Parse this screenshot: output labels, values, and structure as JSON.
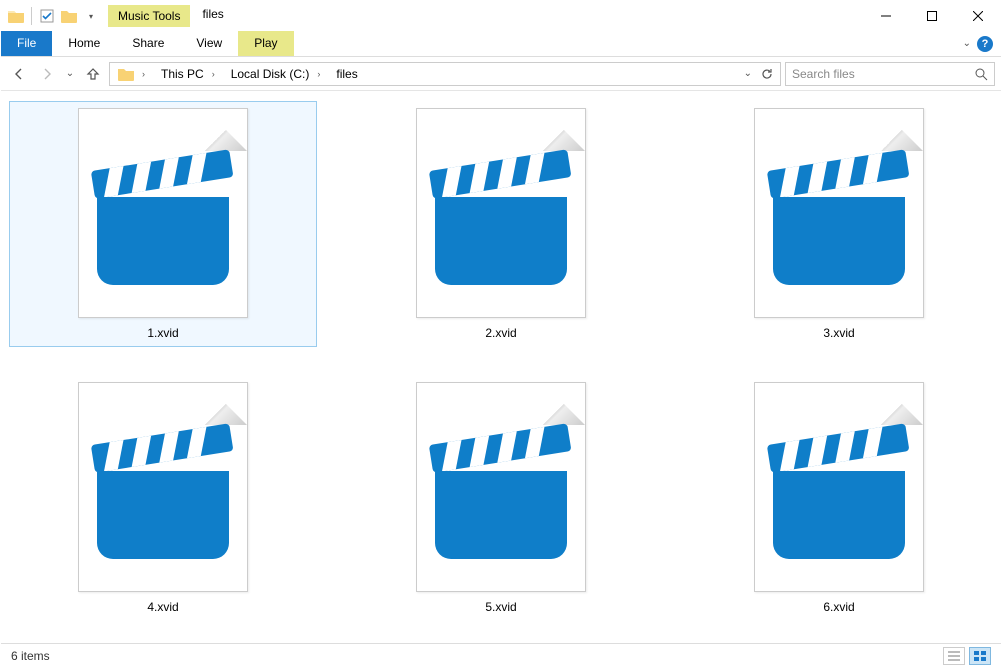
{
  "window": {
    "title": "files",
    "context_tab": "Music Tools"
  },
  "ribbon": {
    "file": "File",
    "tabs": [
      "Home",
      "Share",
      "View"
    ],
    "context_tabs": [
      "Play"
    ]
  },
  "nav": {
    "breadcrumb": [
      "This PC",
      "Local Disk (C:)",
      "files"
    ],
    "search_placeholder": "Search files"
  },
  "files": [
    {
      "name": "1.xvid",
      "selected": true
    },
    {
      "name": "2.xvid",
      "selected": false
    },
    {
      "name": "3.xvid",
      "selected": false
    },
    {
      "name": "4.xvid",
      "selected": false
    },
    {
      "name": "5.xvid",
      "selected": false
    },
    {
      "name": "6.xvid",
      "selected": false
    }
  ],
  "status": {
    "count_text": "6 items"
  }
}
